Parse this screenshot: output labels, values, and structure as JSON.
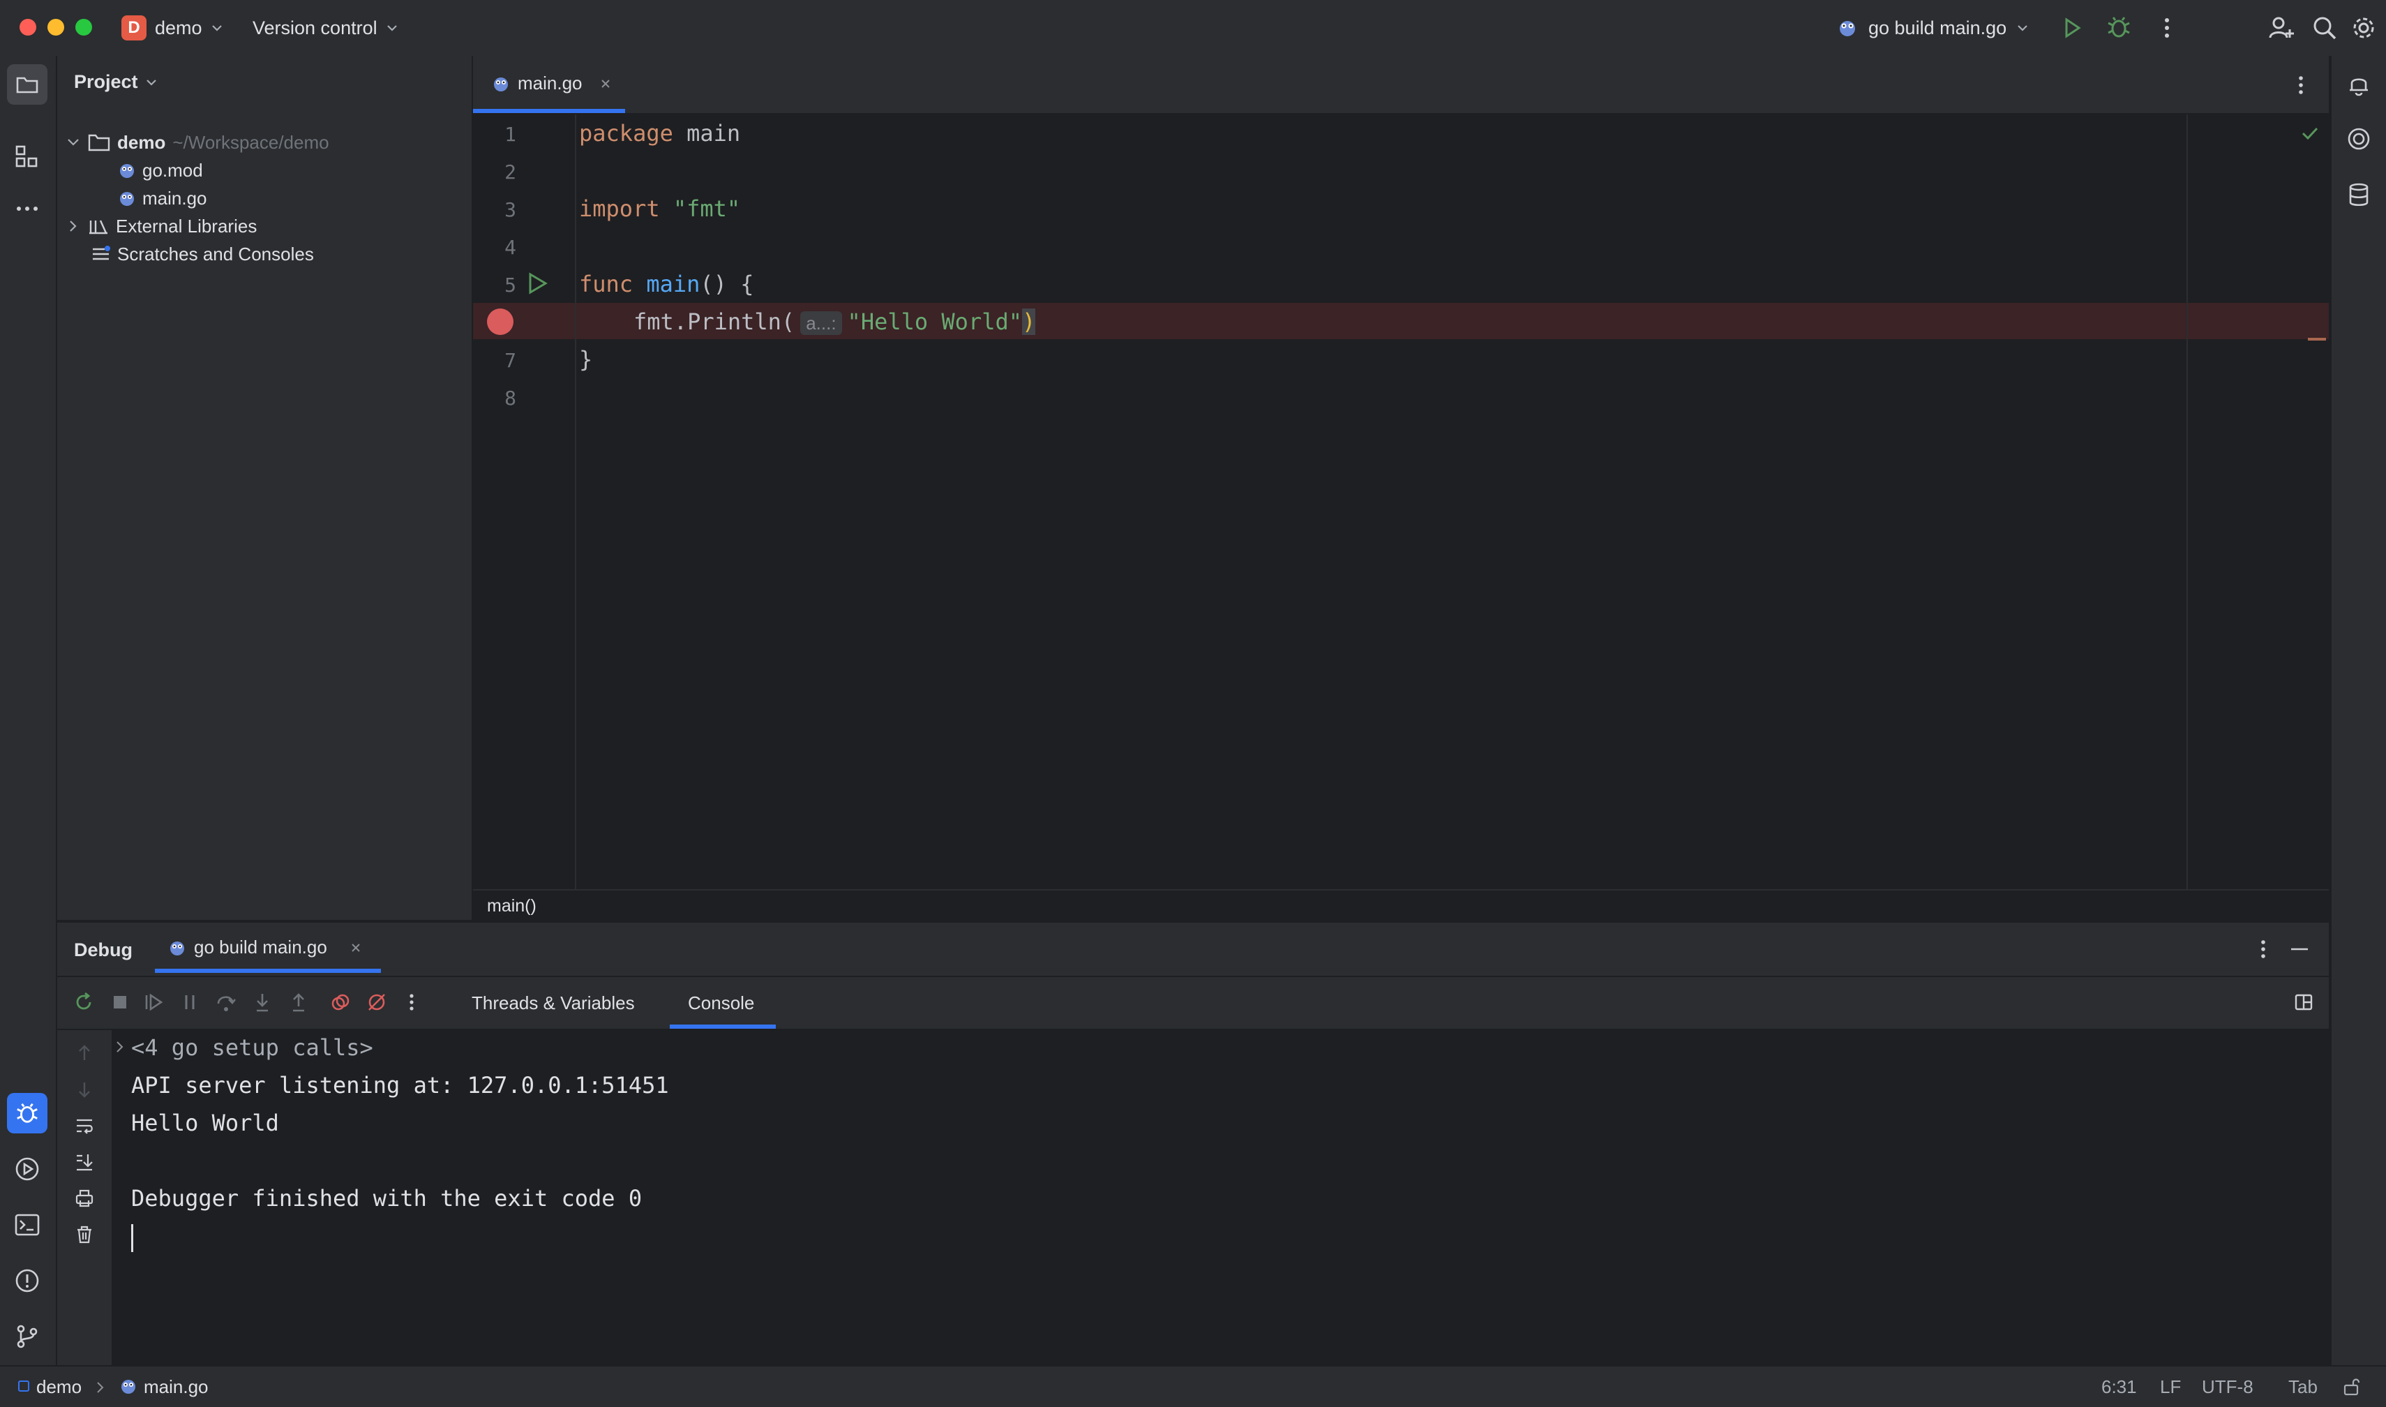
{
  "titlebar": {
    "project_initial": "D",
    "project_name": "demo",
    "version_control": "Version control",
    "run_config": "go build main.go"
  },
  "project_panel": {
    "title": "Project",
    "tree": [
      {
        "label": "demo",
        "hint": "~/Workspace/demo"
      },
      {
        "label": "go.mod"
      },
      {
        "label": "main.go"
      },
      {
        "label": "External Libraries"
      },
      {
        "label": "Scratches and Consoles"
      }
    ]
  },
  "editor": {
    "tab_label": "main.go",
    "line_numbers": [
      "1",
      "2",
      "3",
      "4",
      "5",
      "",
      "7",
      "8"
    ],
    "code": {
      "l1_kw": "package",
      "l1_rest": " main",
      "l3_kw": "import",
      "l3_str": "\"fmt\"",
      "l5_kw": "func",
      "l5_fn": "main",
      "l5_rest": "() {",
      "l6_call": "fmt.Println(",
      "l6_hint": "a...:",
      "l6_str": "\"Hello World\"",
      "l6_close": ")",
      "l7": "}"
    },
    "breadcrumb": "main()"
  },
  "debug_panel": {
    "title": "Debug",
    "session_tab": "go build main.go",
    "tabs": [
      "Threads & Variables",
      "Console"
    ],
    "active_tab": "Console",
    "console_lines": [
      "<4 go setup calls>",
      "API server listening at: 127.0.0.1:51451",
      "Hello World",
      "",
      "Debugger finished with the exit code 0"
    ]
  },
  "statusbar": {
    "path_project": "demo",
    "path_file": "main.go",
    "position": "6:31",
    "line_sep": "LF",
    "encoding": "UTF-8",
    "indent": "Tab"
  },
  "colors": {
    "accent": "#3574f0",
    "run_green": "#57965c",
    "breakpoint": "#db5c5c",
    "project_badge": "#e55b45"
  }
}
